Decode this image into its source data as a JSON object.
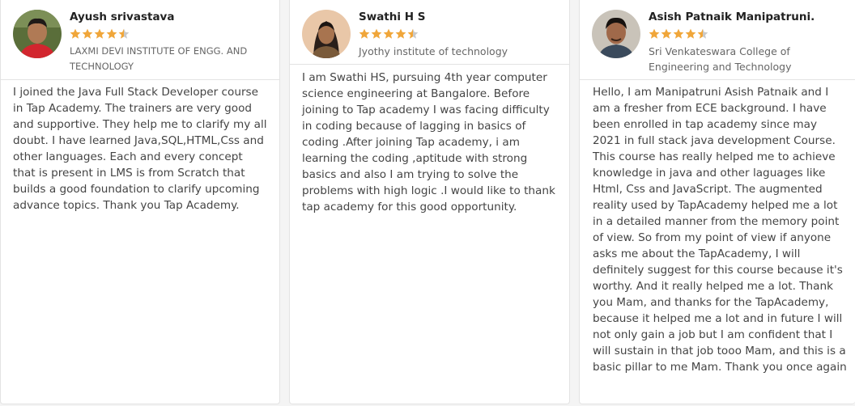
{
  "reviews": [
    {
      "name": "Ayush srivastava",
      "rating": 4.5,
      "institution": "LAXMI DEVI INSTITUTE OF ENGG. AND TECHNOLOGY",
      "text": "I joined the Java Full Stack Developer course in Tap Academy. The trainers are very good and supportive. They help me to clarify my all doubt. I have learned Java,SQL,HTML,Css and other languages. Each and every concept that is present in LMS is from Scratch that builds a good foundation to clarify upcoming advance topics. Thank you Tap Academy."
    },
    {
      "name": "Swathi H S",
      "rating": 4.5,
      "institution": "Jyothy institute of technology",
      "text": "I am Swathi HS, pursuing 4th year computer science engineering at Bangalore. Before joining to Tap academy I was facing difficulty in coding because of lagging in basics of coding .After joining Tap academy, i am learning the coding ,aptitude with strong basics and also I am trying to solve the problems with high logic .I would like to thank tap academy for this good opportunity."
    },
    {
      "name": "Asish Patnaik Manipatruni.",
      "rating": 4.5,
      "institution": "Sri Venkateswara College of Engineering and Technology",
      "text": "Hello, I am Manipatruni Asish Patnaik and I am a fresher from ECE background. I have been enrolled in tap academy since may 2021 in full stack java development Course. This course has really helped me to achieve knowledge in java and other laguages like Html, Css and JavaScript. The augmented reality used by TapAcademy helped me a lot in a detailed manner from the memory point of view. So from my point of view if anyone asks me about the TapAcademy, I will definitely suggest for this course because it's worthy. And it really helped me a lot. Thank you Mam, and thanks for the TapAcademy, because it helped me a lot and in future I will not only gain a job but I am confident that I will sustain in that job tooo Mam, and this is a basic pillar to me Mam. Thank you once again"
    }
  ],
  "colors": {
    "star_filled": "#f0a63a",
    "star_empty": "#c9c9c9",
    "name_text": "#222222",
    "body_text": "#444444",
    "institution_text": "#666666"
  }
}
